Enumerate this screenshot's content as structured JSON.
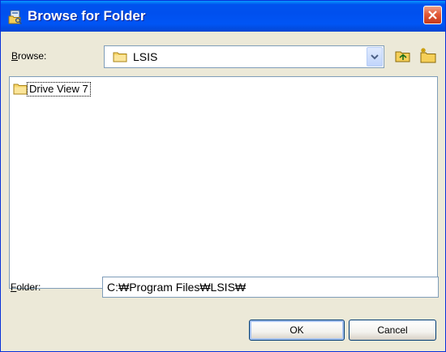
{
  "window": {
    "title": "Browse for Folder",
    "title_icon": "folder-browse-icon",
    "close_icon": "close-icon"
  },
  "browse": {
    "label_accel": "B",
    "label_rest": "rowse:",
    "selected": "LSIS",
    "item_icon": "folder-icon",
    "dropdown_icon": "chevron-down-icon",
    "up_icon": "folder-up-icon",
    "new_folder_icon": "new-folder-icon"
  },
  "list": {
    "items": [
      {
        "label": "Drive View 7",
        "icon": "folder-icon"
      }
    ]
  },
  "folder": {
    "label_accel": "F",
    "label_rest": "older:",
    "value": "C:₩Program Files₩LSIS₩"
  },
  "buttons": {
    "ok": "OK",
    "cancel": "Cancel"
  },
  "colors": {
    "titlebar": "#0055f5",
    "dialog_bg": "#ece9d8",
    "close_button": "#e35b39",
    "field_border": "#7f9db9"
  }
}
